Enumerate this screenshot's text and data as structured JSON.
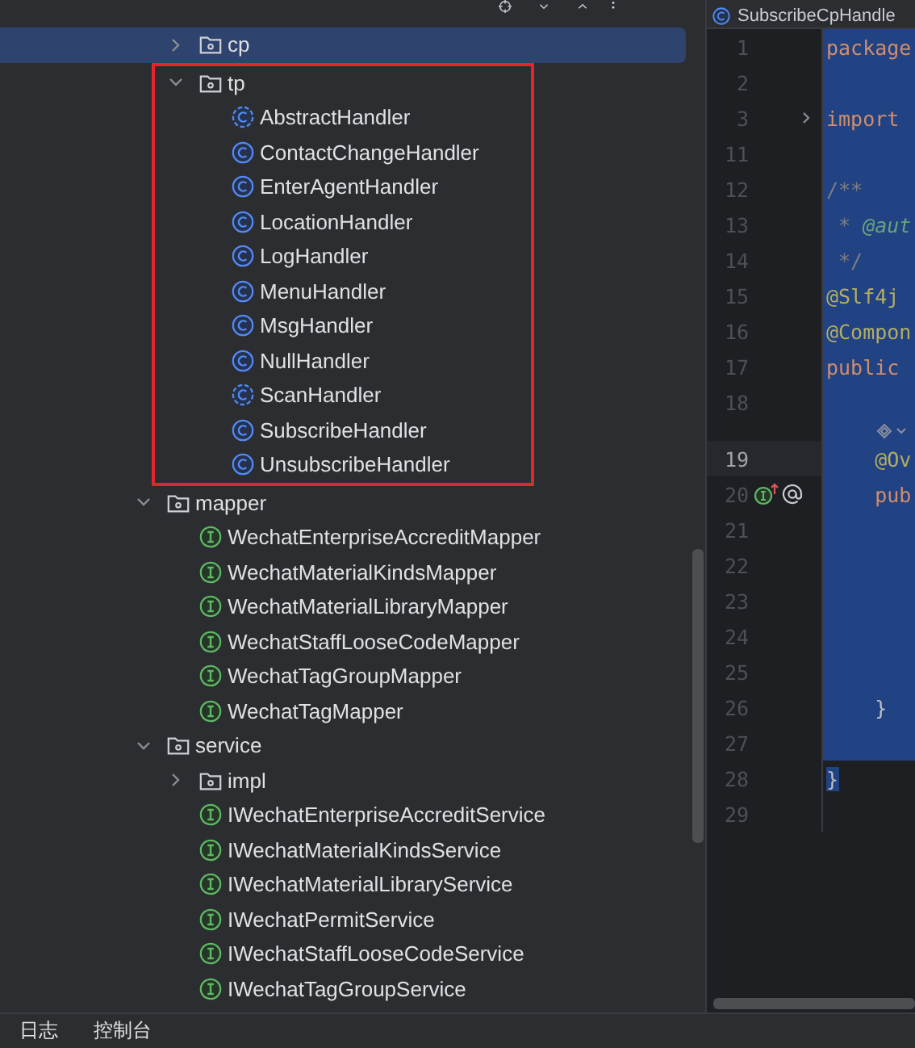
{
  "project_tree": {
    "partial_branch": [
      {
        "label": "cp",
        "kind": "package",
        "expanded": false,
        "selected": true,
        "highlighted": false
      },
      {
        "label": "tp",
        "kind": "package",
        "expanded": true,
        "selected": false,
        "highlighted": true,
        "children": [
          {
            "label": "AbstractHandler",
            "kind": "abstract-class",
            "selected": false
          },
          {
            "label": "ContactChangeHandler",
            "kind": "class",
            "selected": false
          },
          {
            "label": "EnterAgentHandler",
            "kind": "class",
            "selected": false
          },
          {
            "label": "LocationHandler",
            "kind": "class",
            "selected": false
          },
          {
            "label": "LogHandler",
            "kind": "class",
            "selected": false
          },
          {
            "label": "MenuHandler",
            "kind": "class",
            "selected": false
          },
          {
            "label": "MsgHandler",
            "kind": "class",
            "selected": false
          },
          {
            "label": "NullHandler",
            "kind": "class",
            "selected": false
          },
          {
            "label": "ScanHandler",
            "kind": "abstract-class",
            "selected": false
          },
          {
            "label": "SubscribeHandler",
            "kind": "class",
            "selected": false
          },
          {
            "label": "UnsubscribeHandler",
            "kind": "class",
            "selected": false
          }
        ]
      }
    ],
    "items": [
      {
        "label": "mapper",
        "kind": "package",
        "expanded": true,
        "selected": false,
        "highlighted": false,
        "children": [
          {
            "label": "WechatEnterpriseAccreditMapper",
            "kind": "interface",
            "selected": false
          },
          {
            "label": "WechatMaterialKindsMapper",
            "kind": "interface",
            "selected": false
          },
          {
            "label": "WechatMaterialLibraryMapper",
            "kind": "interface",
            "selected": false
          },
          {
            "label": "WechatStaffLooseCodeMapper",
            "kind": "interface",
            "selected": false
          },
          {
            "label": "WechatTagGroupMapper",
            "kind": "interface",
            "selected": false
          },
          {
            "label": "WechatTagMapper",
            "kind": "interface",
            "selected": false
          }
        ]
      },
      {
        "label": "service",
        "kind": "package",
        "expanded": true,
        "selected": false,
        "highlighted": false,
        "children": [
          {
            "label": "impl",
            "kind": "package",
            "expanded": false,
            "selected": false,
            "highlighted": false
          },
          {
            "label": "IWechatEnterpriseAccreditService",
            "kind": "interface",
            "selected": false
          },
          {
            "label": "IWechatMaterialKindsService",
            "kind": "interface",
            "selected": false
          },
          {
            "label": "IWechatMaterialLibraryService",
            "kind": "interface",
            "selected": false
          },
          {
            "label": "IWechatPermitService",
            "kind": "interface",
            "selected": false
          },
          {
            "label": "IWechatStaffLooseCodeService",
            "kind": "interface",
            "selected": false
          },
          {
            "label": "IWechatTagGroupService",
            "kind": "interface",
            "selected": false
          }
        ]
      }
    ]
  },
  "editor": {
    "tab": {
      "label": "SubscribeCpHandle",
      "kind": "class"
    },
    "lines": [
      {
        "number": "1",
        "kind": "line",
        "current": false,
        "selected": true,
        "tokens": [
          {
            "text": "package",
            "kind": "keyword"
          }
        ]
      },
      {
        "number": "2",
        "kind": "line",
        "current": false,
        "selected": true
      },
      {
        "number": "3",
        "kind": "folded",
        "current": false,
        "selected": true,
        "tokens": [
          {
            "text": "import",
            "kind": "keyword"
          }
        ]
      },
      {
        "number": "11",
        "kind": "line",
        "current": false,
        "selected": true
      },
      {
        "number": "12",
        "kind": "line",
        "current": false,
        "selected": true,
        "tokens": [
          {
            "text": "/**",
            "kind": "comment"
          }
        ]
      },
      {
        "number": "13",
        "kind": "line",
        "current": false,
        "selected": true,
        "tokens": [
          {
            "text": " * ",
            "kind": "comment"
          },
          {
            "text": "@aut",
            "kind": "doc-tag"
          }
        ]
      },
      {
        "number": "14",
        "kind": "line",
        "current": false,
        "selected": true,
        "tokens": [
          {
            "text": " */",
            "kind": "comment"
          }
        ]
      },
      {
        "number": "15",
        "kind": "line",
        "current": false,
        "selected": true,
        "tokens": [
          {
            "text": "@Slf4j",
            "kind": "annotation"
          }
        ]
      },
      {
        "number": "16",
        "kind": "line",
        "current": false,
        "selected": true,
        "tokens": [
          {
            "text": "@Compon",
            "kind": "annotation"
          }
        ]
      },
      {
        "number": "17",
        "kind": "line",
        "current": false,
        "selected": true,
        "tokens": [
          {
            "text": "public",
            "kind": "keyword"
          }
        ]
      },
      {
        "number": "18",
        "kind": "line",
        "current": false,
        "selected": true
      },
      {
        "kind": "inlay",
        "current": false,
        "selected": true
      },
      {
        "number": "19",
        "kind": "line",
        "current": true,
        "selected": true,
        "tokens": [
          {
            "text": "    @Ov",
            "kind": "annotation"
          }
        ]
      },
      {
        "number": "20",
        "kind": "method",
        "current": false,
        "selected": true,
        "tokens": [
          {
            "text": "    pub",
            "kind": "keyword"
          }
        ]
      },
      {
        "number": "21",
        "kind": "line",
        "current": false,
        "selected": true
      },
      {
        "number": "22",
        "kind": "line",
        "current": false,
        "selected": true
      },
      {
        "number": "23",
        "kind": "line",
        "current": false,
        "selected": true
      },
      {
        "number": "24",
        "kind": "line",
        "current": false,
        "selected": true
      },
      {
        "number": "25",
        "kind": "line",
        "current": false,
        "selected": true
      },
      {
        "number": "26",
        "kind": "line",
        "current": false,
        "selected": true,
        "tokens": [
          {
            "text": "    }",
            "kind": "plain"
          }
        ]
      },
      {
        "number": "27",
        "kind": "line",
        "current": false,
        "selected": true
      },
      {
        "number": "28",
        "kind": "line",
        "current": false,
        "selected": true,
        "tokens": [
          {
            "text": "}",
            "kind": "plain"
          }
        ]
      },
      {
        "number": "29",
        "kind": "line",
        "current": false,
        "selected": false
      }
    ]
  },
  "bottom_bar": {
    "tabs": [
      {
        "label": "日志"
      },
      {
        "label": "控制台"
      }
    ]
  }
}
